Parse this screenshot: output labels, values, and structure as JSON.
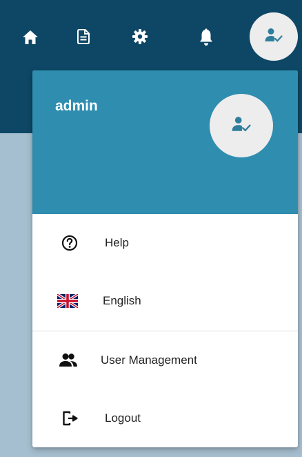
{
  "topbar": {
    "icons": [
      "home-icon",
      "document-icon",
      "gear-icon",
      "bell-icon",
      "user-check-icon"
    ]
  },
  "menu": {
    "username": "admin",
    "avatar_icon": "user-check-icon",
    "items": [
      {
        "label": "Help",
        "icon": "help-circle-icon"
      },
      {
        "label": "English",
        "icon": "uk-flag-icon"
      },
      {
        "label": "User Management",
        "icon": "users-icon"
      },
      {
        "label": "Logout",
        "icon": "logout-icon"
      }
    ]
  },
  "colors": {
    "topbar": "#0e4766",
    "menu_header": "#2f8db0",
    "backdrop": "#a6bfd0",
    "avatar_bg": "#ededed",
    "avatar_icon": "#2f7f9c"
  }
}
